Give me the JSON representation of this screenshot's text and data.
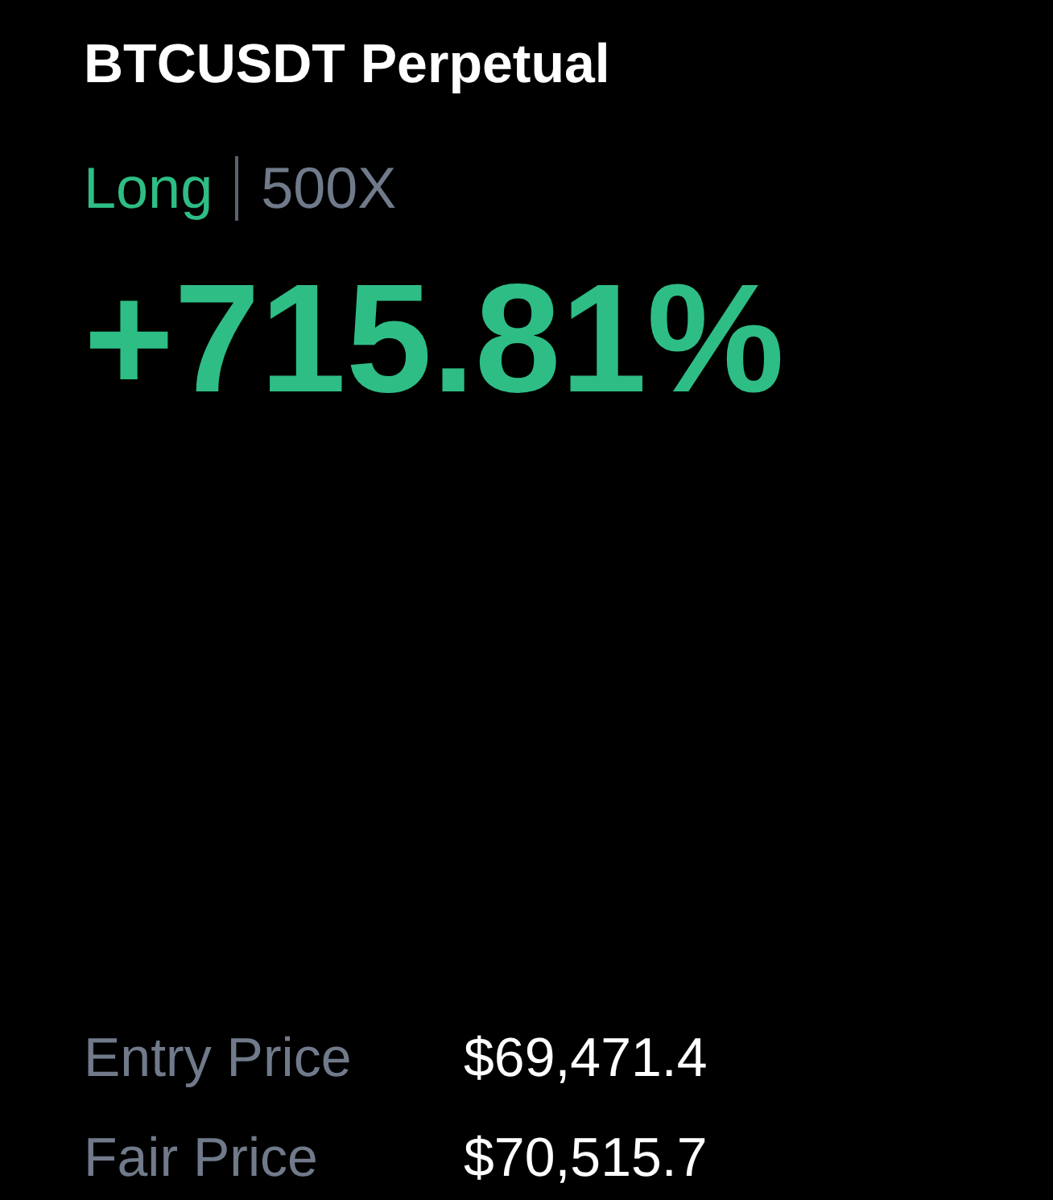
{
  "title": "BTCUSDT Perpetual",
  "position": {
    "side": "Long",
    "kind": "long",
    "leverage": "500X"
  },
  "pnl_percent": "+715.81%",
  "details": [
    {
      "label": "Entry Price",
      "value": "$69,471.4"
    },
    {
      "label": "Fair Price",
      "value": "$70,515.7"
    }
  ]
}
